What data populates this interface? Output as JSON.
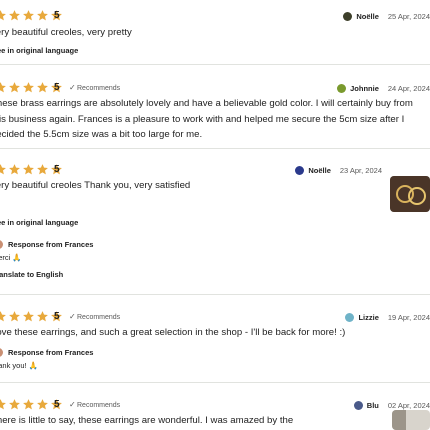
{
  "reviews": [
    {
      "rating": "5",
      "recommends": "",
      "user": "Noëlle",
      "date": "25 Apr, 2024",
      "text_lines": [
        "very beautiful creoles, very pretty"
      ],
      "translation_note": "See in original language"
    },
    {
      "rating": "5",
      "recommends": "Recommends",
      "user": "Johnnie",
      "date": "24 Apr, 2024",
      "text_lines": [
        "These brass earrings are absolutely lovely and have a believable gold color. I will certainly buy from",
        "this business again. Frances is a pleasure to work with and helped me secure the 5cm size after I",
        "decided the 5.5cm size was a bit too large for me."
      ]
    },
    {
      "rating": "5",
      "recommends": "",
      "user": "Noëlle",
      "date": "23 Apr, 2024",
      "text_lines": [
        "very beautiful creoles Thank you, very satisfied"
      ],
      "translation_note": "See in original language",
      "response_label": "Response from Frances",
      "response_text": "merci 🙏",
      "translate_link": "Translate to English"
    },
    {
      "rating": "5",
      "recommends": "Recommends",
      "user": "Lizzie",
      "date": "19 Apr, 2024",
      "text_lines": [
        "Love these earrings, and such a great selection in the shop - I'll be back for more! :)"
      ],
      "response_label": "Response from Frances",
      "response_text": "thank you! 🙏"
    },
    {
      "rating": "5",
      "recommends": "Recommends",
      "user": "Blu",
      "date": "02 Apr, 2024",
      "text_lines": [
        "There is little to say, these earrings are wonderful. I was amazed by the"
      ]
    }
  ],
  "colors": {
    "star": "#e8a93c",
    "divider": "#e1e3df",
    "muted": "#595959"
  },
  "icons": {
    "star": "star-icon",
    "recommend": "check-icon",
    "response_avatar": "shop-avatar"
  }
}
